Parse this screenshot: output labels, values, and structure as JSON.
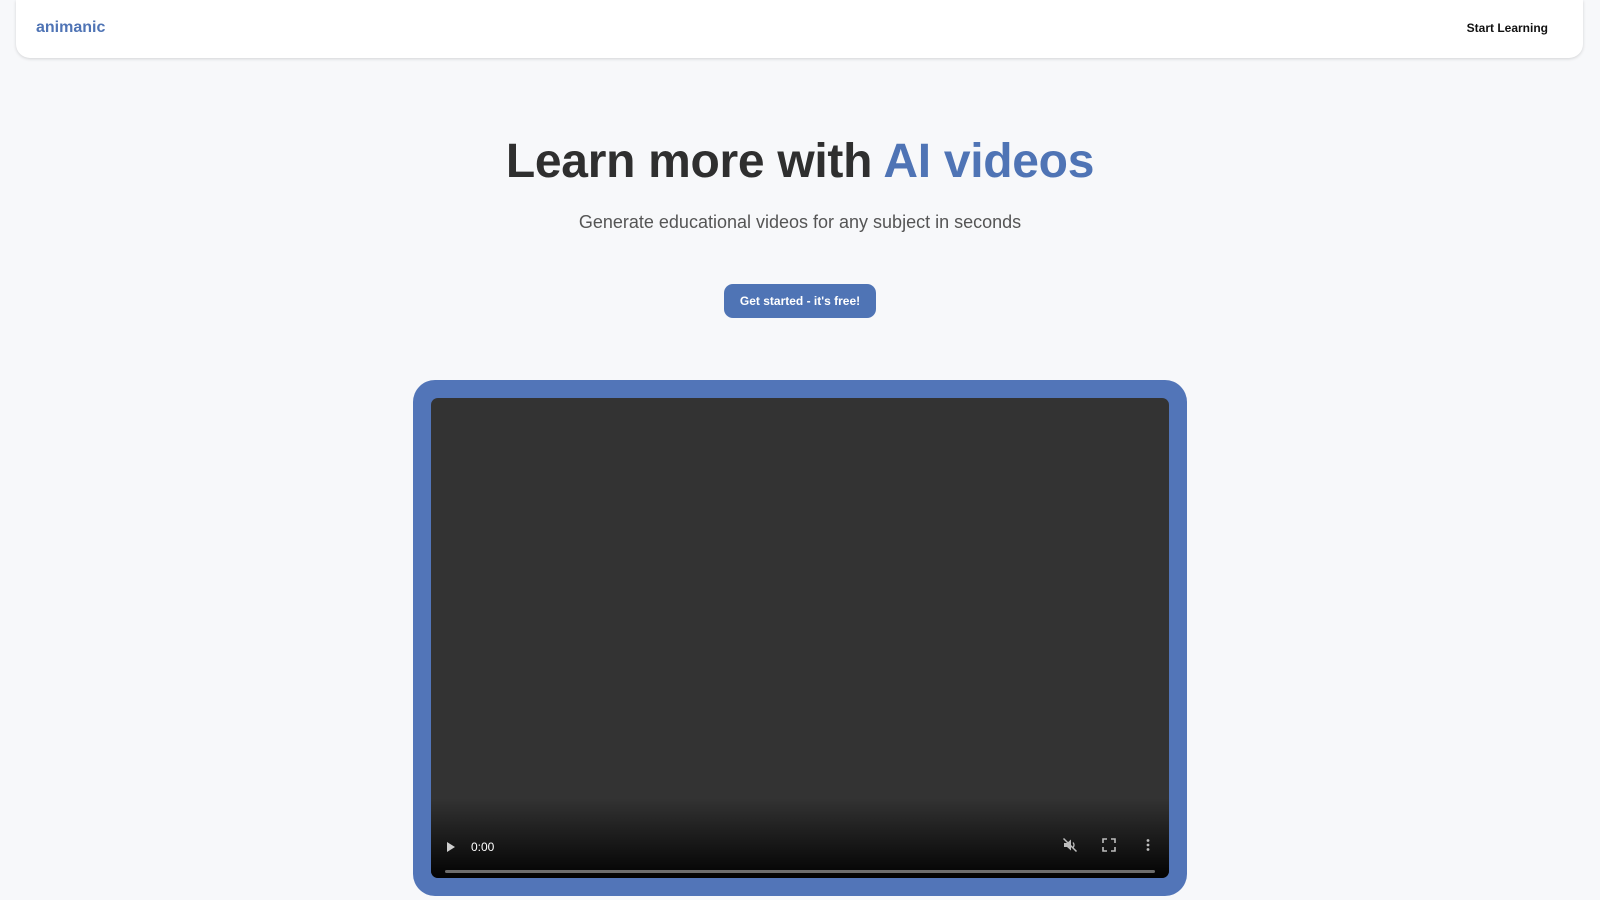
{
  "navbar": {
    "brand": "animanic",
    "link": "Start Learning"
  },
  "hero": {
    "headline_main": "Learn more with ",
    "headline_accent": "AI videos",
    "subtitle": "Generate educational videos for any subject in seconds",
    "cta_label": "Get started - it's free!"
  },
  "video": {
    "current_time": "0:00",
    "progress": 0,
    "icons": [
      "play-icon",
      "mute-icon",
      "fullscreen-icon",
      "more-options-icon"
    ]
  },
  "colors": {
    "accent": "#4f74b5",
    "frame": "#5275b8",
    "background": "#f7f8fa",
    "video_bg": "#333333",
    "heading": "#2f2f2f"
  }
}
